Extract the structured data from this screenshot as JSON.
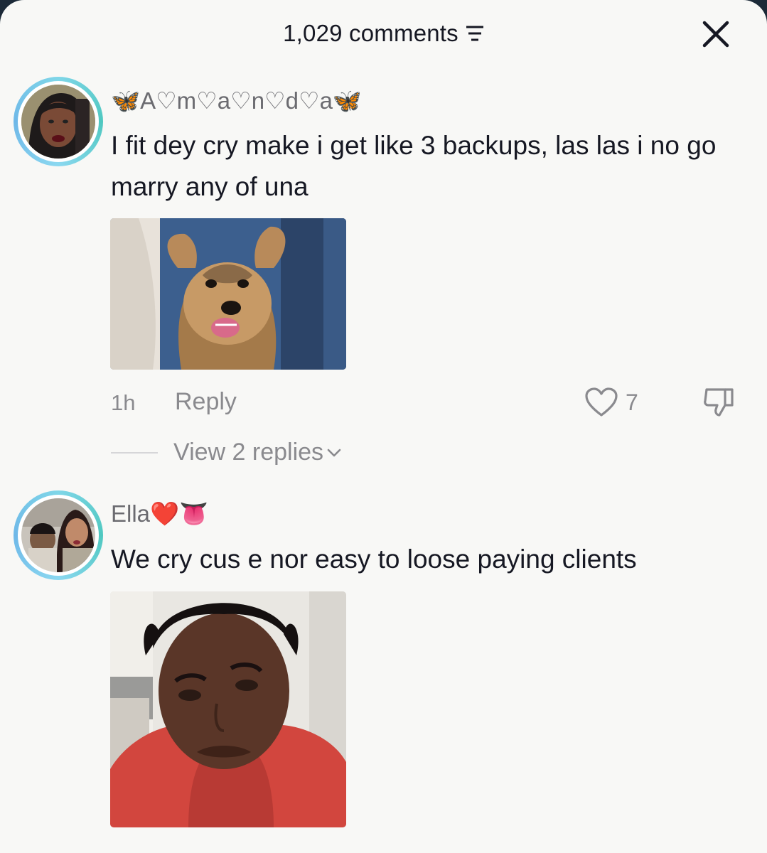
{
  "header": {
    "comments_count": "1,029 comments"
  },
  "comments": [
    {
      "username": "🦋A♡m♡a♡n♡d♡a🦋",
      "text": "I fit dey cry make i get like 3 backups, las las i no go marry any of una",
      "time": "1h",
      "reply_label": "Reply",
      "likes": "7",
      "view_replies": "View 2 replies"
    },
    {
      "username": "Ella❤️👅",
      "text": "We cry cus e nor easy to loose paying clients"
    }
  ],
  "colors": {
    "background": "#f8f8f6",
    "text_primary": "#161823",
    "text_secondary": "#8a8a8e",
    "avatar_ring": "#6fcfdc"
  }
}
